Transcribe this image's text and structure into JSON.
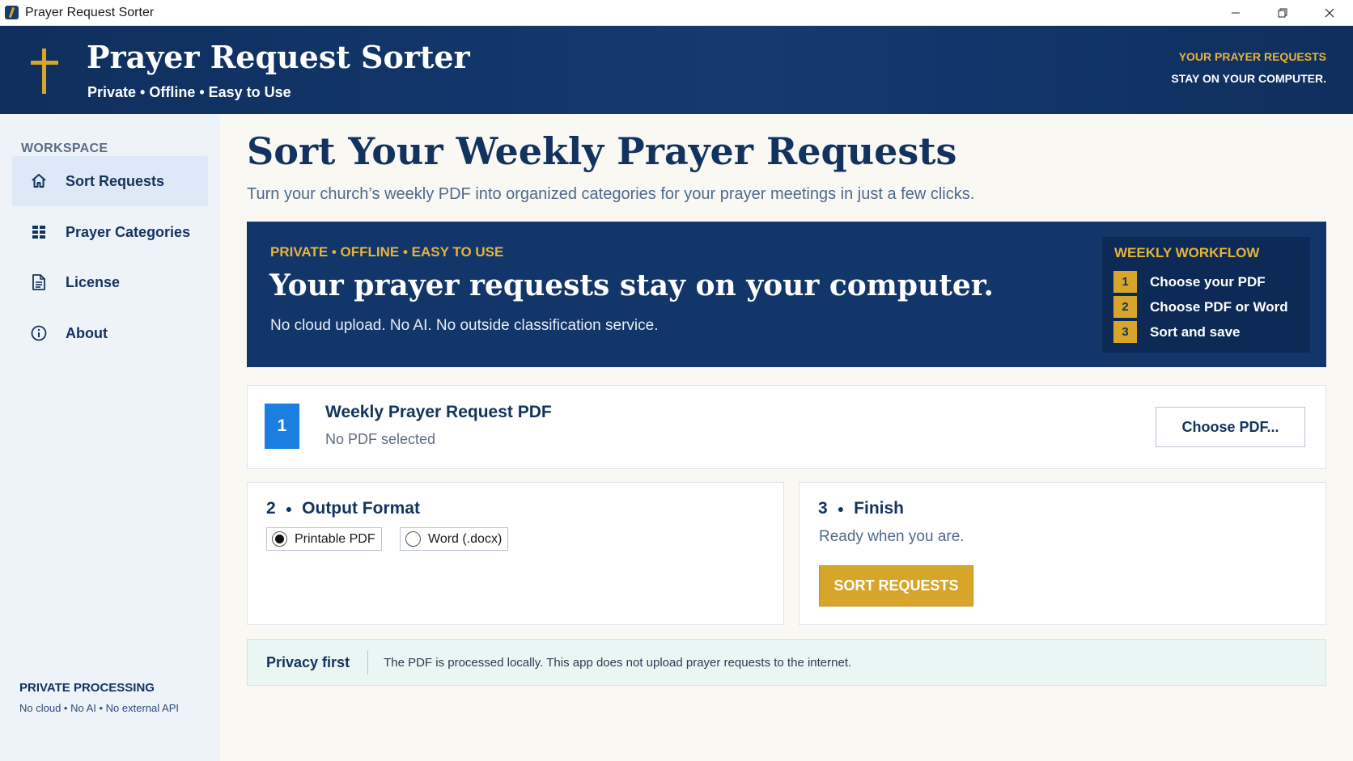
{
  "window": {
    "title": "Prayer Request Sorter",
    "controls": {
      "minimize": "—",
      "restore": "❐",
      "close": "✕"
    }
  },
  "header": {
    "title": "Prayer Request Sorter",
    "tagline": "Private • Offline • Easy to Use",
    "notice_line1": "YOUR PRAYER REQUESTS",
    "notice_line2": "STAY ON YOUR COMPUTER."
  },
  "sidebar": {
    "section_label": "WORKSPACE",
    "items": [
      {
        "label": "Sort Requests",
        "icon": "home-icon",
        "active": true
      },
      {
        "label": "Prayer Categories",
        "icon": "grid-icon",
        "active": false
      },
      {
        "label": "License",
        "icon": "document-icon",
        "active": false
      },
      {
        "label": "About",
        "icon": "info-icon",
        "active": false
      }
    ],
    "footer_title": "PRIVATE PROCESSING",
    "footer_text": "No cloud • No AI • No external API"
  },
  "main": {
    "title": "Sort Your Weekly Prayer Requests",
    "subtitle": "Turn your church’s weekly PDF into organized categories for your prayer meetings in just a few clicks."
  },
  "banner": {
    "kicker": "PRIVATE • OFFLINE • EASY TO USE",
    "headline": "Your prayer requests stay on your computer.",
    "description": "No cloud upload. No AI. No outside classification service.",
    "workflow": {
      "title": "WEEKLY WORKFLOW",
      "steps": [
        {
          "num": "1",
          "text": "Choose your PDF"
        },
        {
          "num": "2",
          "text": "Choose PDF or Word"
        },
        {
          "num": "3",
          "text": "Sort and save"
        }
      ]
    }
  },
  "step1": {
    "num": "1",
    "title": "Weekly Prayer Request PDF",
    "status": "No PDF selected",
    "button": "Choose PDF..."
  },
  "step2": {
    "num": "2",
    "title": "Output Format",
    "options": [
      {
        "label": "Printable PDF",
        "selected": true
      },
      {
        "label": "Word (.docx)",
        "selected": false
      }
    ]
  },
  "step3": {
    "num": "3",
    "title": "Finish",
    "status": "Ready when you are.",
    "button": "SORT REQUESTS"
  },
  "privacy": {
    "title": "Privacy first",
    "text": "The PDF is processed locally. This app does not upload prayer requests to the internet."
  },
  "colors": {
    "navy": "#13335f",
    "gold": "#d8a52b",
    "blue_badge": "#1a7fe0",
    "privacy_bg": "#eaf6f3"
  }
}
